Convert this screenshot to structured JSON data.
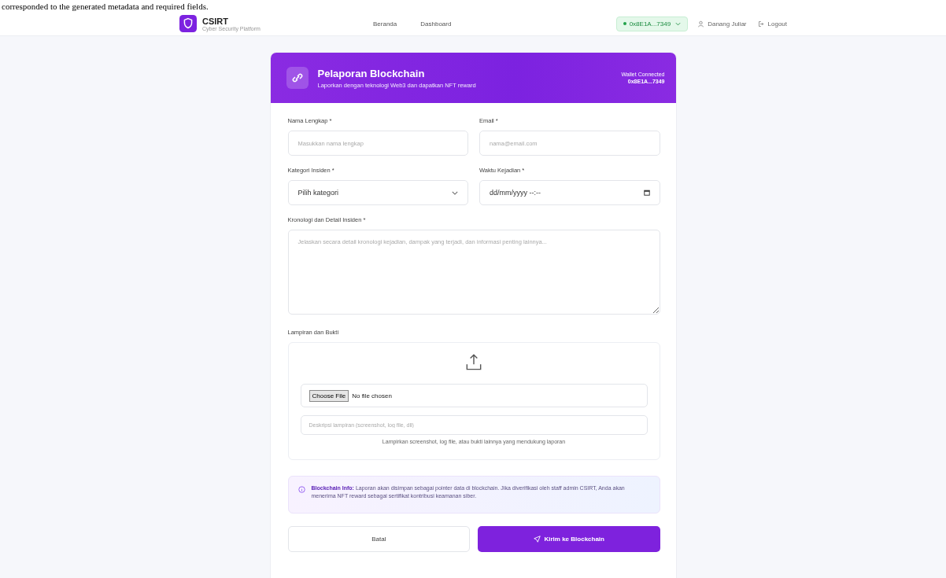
{
  "overlay_text": "corresponded to the generated metadata and required fields.",
  "nav": {
    "logo_title": "CSIRT",
    "logo_subtitle": "Cyber Security Platform",
    "links": [
      {
        "label": "Beranda",
        "selected": false
      },
      {
        "label": "Dashboard",
        "selected": false
      }
    ],
    "wallet": "0x8E1A...7349",
    "user": "Danang Juliar",
    "logout": "Logout"
  },
  "form": {
    "title": "Pelaporan Blockchain",
    "subtitle": "Laporkan dengan teknologi Web3 dan dapatkan NFT reward",
    "wallet_label": "Wallet Connected",
    "wallet_address": "0x8E1A...7349",
    "fields": [
      {
        "kind": "text",
        "label": "Nama Lengkap *",
        "placeholder": "Masukkan nama lengkap"
      },
      {
        "kind": "text",
        "label": "Email *",
        "placeholder": "nama@email.com"
      },
      {
        "kind": "select",
        "label": "Kategori Insiden *",
        "value": "Pilih kategori"
      },
      {
        "kind": "datetime",
        "label": "Waktu Kejadian *",
        "value": "dd/mm/yyyy --:--"
      },
      {
        "kind": "textarea",
        "label": "Kronologi dan Detail Insiden *",
        "placeholder": "Jelaskan secara detail kronologi kejadian, dampak yang terjadi, dan informasi penting lainnya..."
      }
    ],
    "attachment": {
      "label": "Lampiran dan Bukti",
      "file_button": "Choose File",
      "file_status": "No file chosen",
      "description_placeholder": "Deskripsi lampiran (screenshot, log file, dll)",
      "help": "Lampirkan screenshot, log file, atau bukti lainnya yang mendukung laporan"
    },
    "info": "**Blockchain Info:** Laporan akan disimpan sebagai pointer data di blockchain. Jika diverifikasi oleh staff admin CSIRT, Anda akan menerima NFT reward sebagai sertifikat kontribusi keamanan siber.",
    "buttons": [
      {
        "kind": "secondary",
        "label": "Batal"
      },
      {
        "kind": "primary",
        "label": "Kirim ke Blockchain"
      }
    ]
  }
}
